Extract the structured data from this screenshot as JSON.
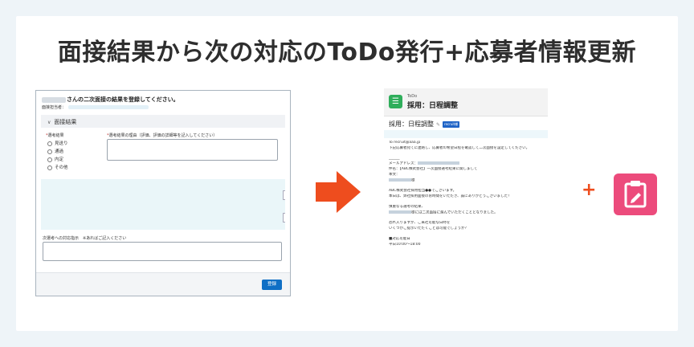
{
  "headline": "面接結果から次の対応のToDo発行+応募者情報更新",
  "form": {
    "title": "さんの二次面接の結果を登録してください。",
    "interviewer_label": "面接担当者：",
    "section_label": "面接結果",
    "result_label": "選考結果",
    "result_options": [
      "見送り",
      "通過",
      "内定",
      "その他"
    ],
    "reason_label": "選考結果の理由（評価、評価の詳細等を記入してください）",
    "next_label": "次選考への対応指示　※あればご記入ください",
    "save_label": "登録"
  },
  "todo": {
    "type_label": "ToDo",
    "title": "採用：日程調整",
    "subject": "採用：日程調整",
    "badge": "recruit様",
    "to_line": "To recruit@aaa.jp",
    "body_lines": [
      "下記応募者宛てに連絡し、応募者の希望日程を確認して二次面接を設定してください。",
      "",
      "______",
      "メールアドレス：",
      "件名：【ABC株式会社】一次面接選考結果に関しまして",
      "本文：",
      "様",
      "",
      "ABC株式会社採用担当●●でございます。",
      "本日は、弊社採用面接のお時間をいただき、誠にありがとうございました！",
      "",
      "慎重なる選考の結果、",
      "様には二次面接に進んでいただくこととなりました。",
      "",
      "恐れ入りますが、ご来社可能な日時を",
      "いくつかご提示いただくことは可能でしょうか？",
      "",
      "■対応可能日",
      "平日10:00～18:00"
    ]
  },
  "colors": {
    "accent_orange": "#ee4d1e",
    "todo_green": "#2fae5b",
    "clipboard_pink": "#ec4b7c",
    "save_blue": "#0f6fc5"
  },
  "icons": {
    "arrow": "arrow-right-icon",
    "plus": "plus-icon",
    "clipboard": "clipboard-edit-icon",
    "todo": "todo-check-icon"
  }
}
